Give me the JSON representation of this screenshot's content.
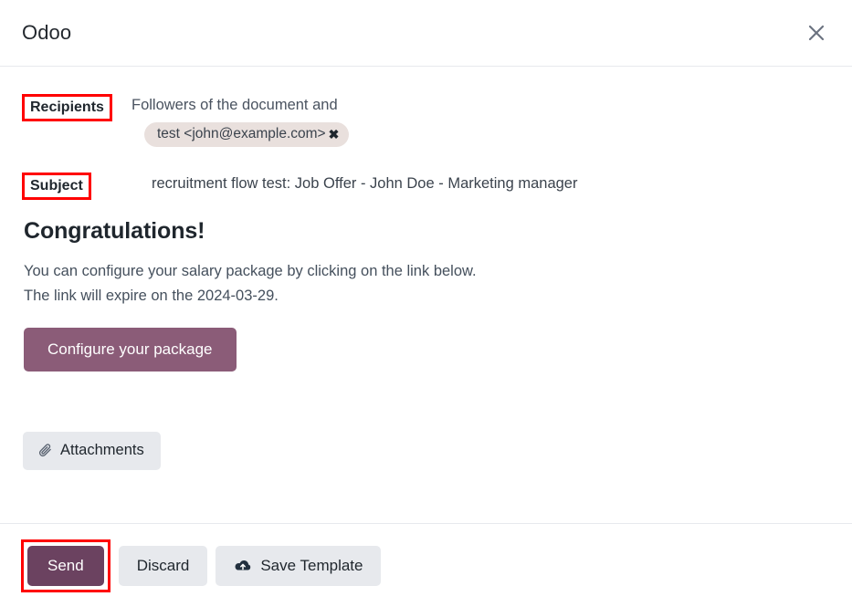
{
  "dialog": {
    "title": "Odoo",
    "close_label": "×"
  },
  "form": {
    "recipients": {
      "label": "Recipients",
      "description": "Followers of the document and",
      "chips": [
        {
          "text": "test <john@example.com>",
          "remove_label": "✖"
        }
      ]
    },
    "subject": {
      "label": "Subject",
      "value": "recruitment flow test: Job Offer - John Doe - Marketing manager"
    }
  },
  "email_body": {
    "heading": "Congratulations!",
    "line1": "You can configure your salary package by clicking on the link below.",
    "line2": "The link will expire on the 2024-03-29.",
    "cta_label": "Configure your package"
  },
  "attachments": {
    "label": "Attachments",
    "icon": "paperclip-icon"
  },
  "footer": {
    "send_label": "Send",
    "discard_label": "Discard",
    "save_template_label": "Save Template",
    "save_template_icon": "cloud-upload-icon"
  },
  "colors": {
    "accent_cta": "#8b5c78",
    "accent_send": "#6b4260",
    "secondary_button": "#e7e9ed",
    "chip_background": "#e9e0dd",
    "annotation_red": "#ff0000",
    "text_primary": "#1f262d",
    "text_body": "#45505d",
    "divider": "#e7e9ed"
  }
}
